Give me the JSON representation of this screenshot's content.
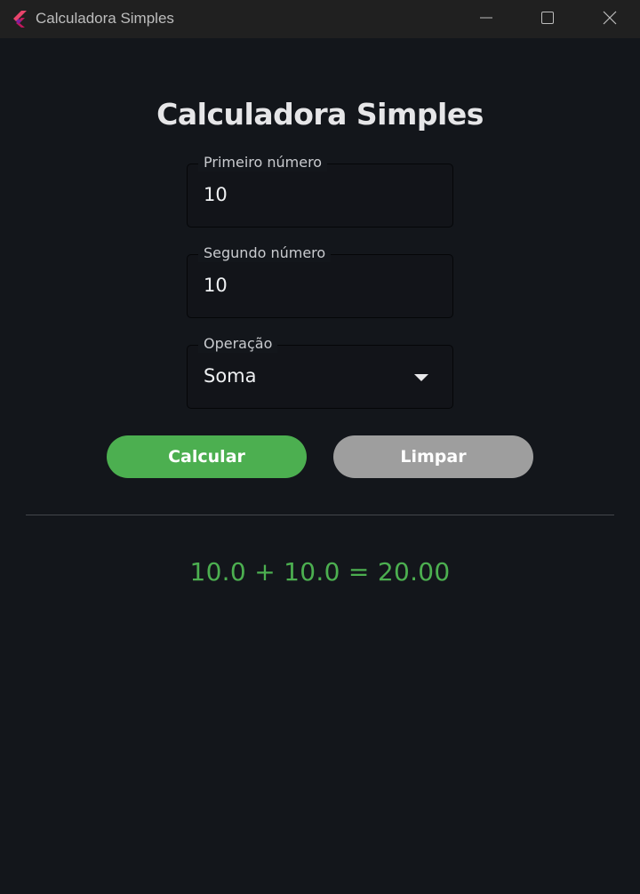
{
  "window": {
    "title": "Calculadora Simples",
    "logo_icon": "flutter-logo-icon",
    "controls": [
      "minimize-icon",
      "maximize-icon",
      "close-icon"
    ]
  },
  "page": {
    "title": "Calculadora Simples"
  },
  "form": {
    "first_number": {
      "label": "Primeiro número",
      "value": "10"
    },
    "second_number": {
      "label": "Segundo número",
      "value": "10"
    },
    "operation": {
      "label": "Operação",
      "selected": "Soma"
    }
  },
  "actions": {
    "calculate_label": "Calcular",
    "clear_label": "Limpar"
  },
  "result": {
    "text": "10.0 + 10.0 = 20.00"
  },
  "colors": {
    "background": "#13161b",
    "titlebar": "#202020",
    "accent_green": "#4caf50",
    "button_gray": "#9e9e9e"
  }
}
